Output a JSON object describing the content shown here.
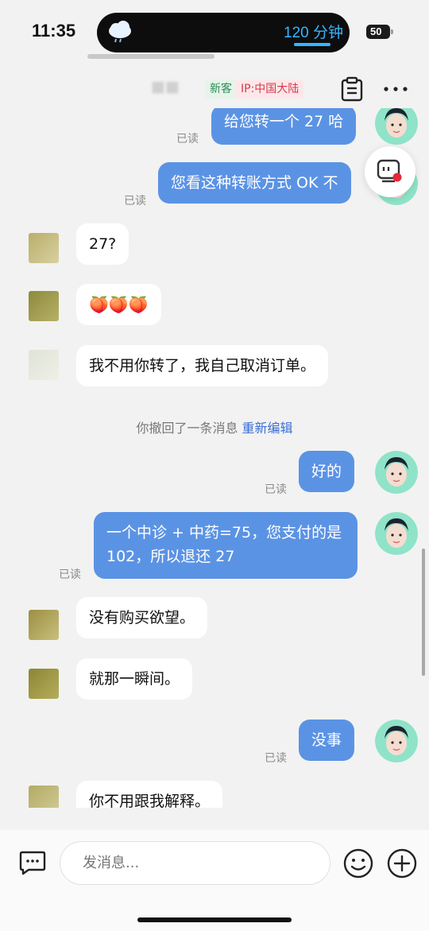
{
  "status": {
    "time": "11:35",
    "timer": "120 分钟",
    "battery": "50"
  },
  "header": {
    "tag_new": "新客",
    "tag_ip": "IP:中国大陆"
  },
  "messages": [
    {
      "text": "给您转一个 27 哈",
      "read": "已读"
    },
    {
      "text": "您看这种转账方式 OK 不",
      "read": "已读"
    },
    {
      "text": "27?"
    },
    {
      "text": "🍑🍑🍑"
    },
    {
      "text": "我不用你转了，我自己取消订单。"
    },
    {
      "text": "好的",
      "read": "已读"
    },
    {
      "line1": "一个中诊 + 中药=75，您支付的是",
      "line2": "102，所以退还 27",
      "read": "已读"
    },
    {
      "text": "没有购买欲望。"
    },
    {
      "text": "就那一瞬间。"
    },
    {
      "text": "没事",
      "read": "已读"
    },
    {
      "text": "你不用跟我解释。"
    }
  ],
  "recall": {
    "text": "你撤回了一条消息",
    "link": "重新编辑"
  },
  "input": {
    "placeholder": "发消息..."
  },
  "colors": {
    "outgoing_bubble": "#5b93e4",
    "incoming_bubble": "#ffffff",
    "link": "#3b6fd6",
    "timer": "#36b5ff"
  }
}
